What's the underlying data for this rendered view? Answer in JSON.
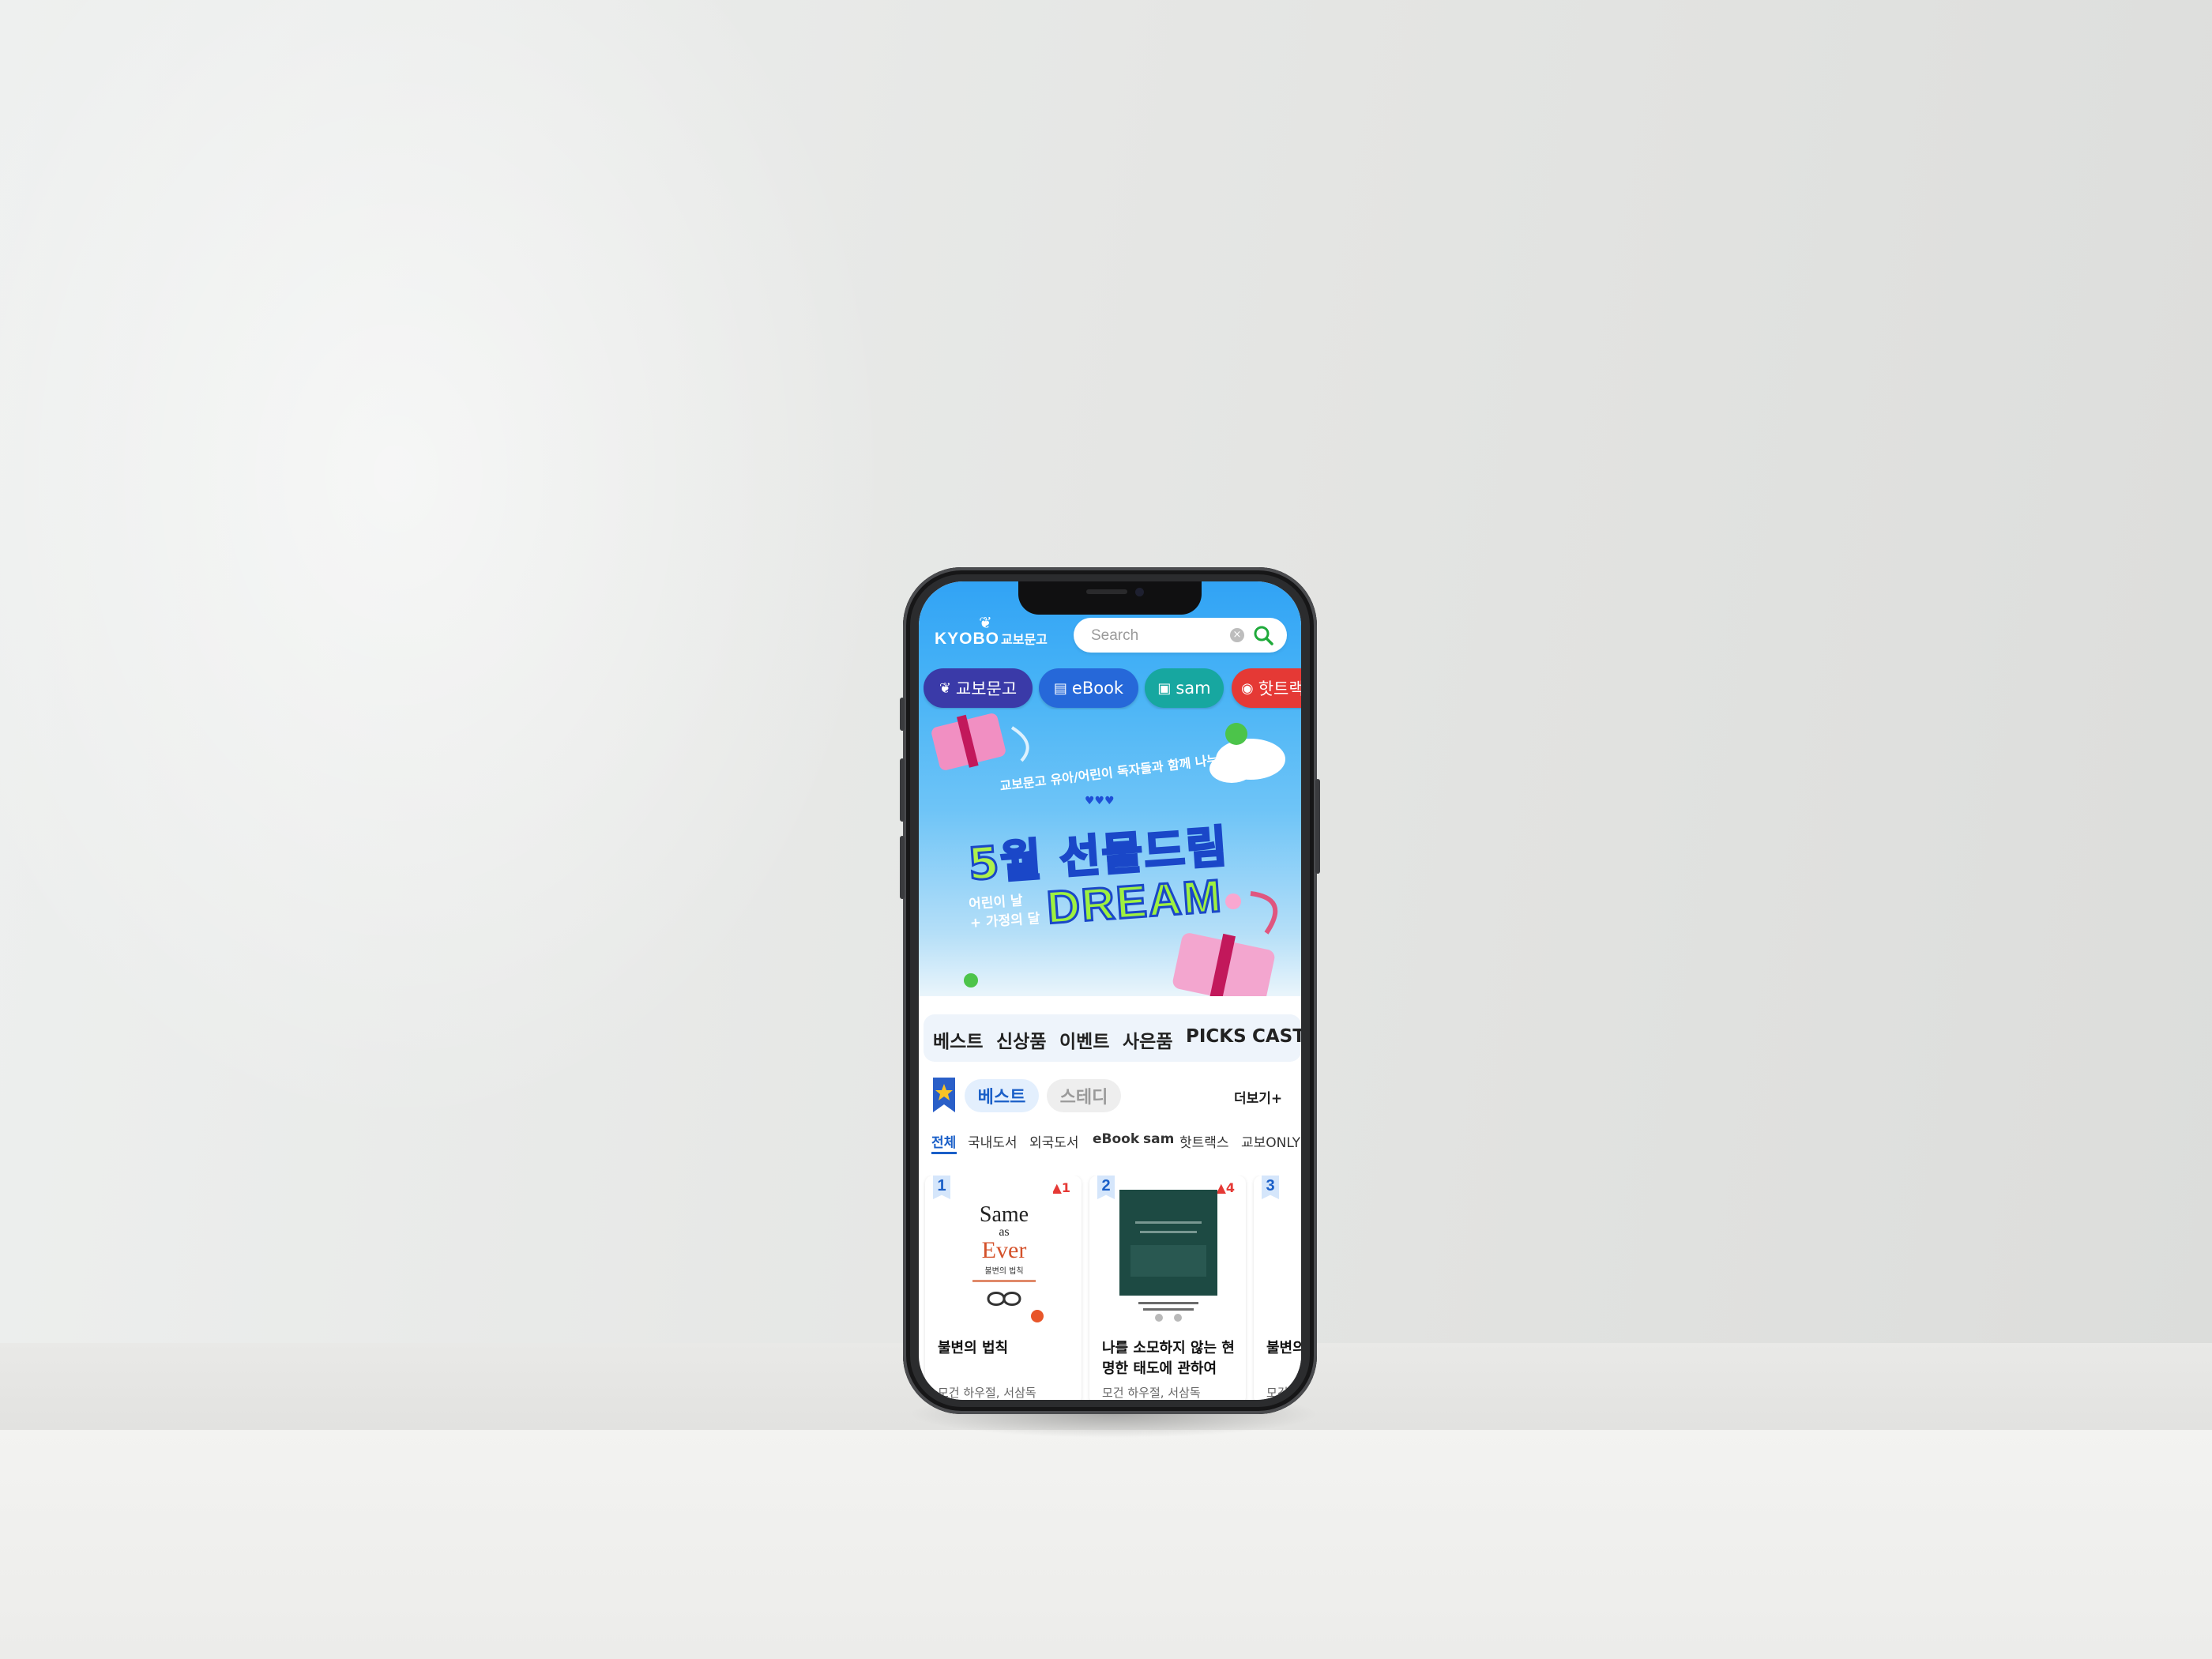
{
  "app": {
    "logo_text": "KYOBO",
    "logo_sub": "교보문고"
  },
  "search": {
    "placeholder": "Search"
  },
  "chips": [
    {
      "label": "교보문고",
      "icon": "bird-icon",
      "color": "#3a3aa8"
    },
    {
      "label": "eBook",
      "icon": "book-icon",
      "color": "#2668d9"
    },
    {
      "label": "sam",
      "icon": "tablet-icon",
      "color": "#17a7a0"
    },
    {
      "label": "핫트랙스",
      "icon": "target-icon",
      "color": "#e53935"
    }
  ],
  "banner": {
    "subtitle": "교보문고 유아/어린이 독자들과 함께 나누는",
    "hearts": "♥♥♥",
    "title": "5월 선물드림",
    "dream": "DREAM",
    "side_line1": "어린이 날",
    "side_line2": "+ 가정의 달"
  },
  "tabs": [
    "베스트",
    "신상품",
    "이벤트",
    "사은품",
    "PICKS",
    "CAST"
  ],
  "best": {
    "pill_active": "베스트",
    "pill_inactive": "스테디",
    "more": "더보기+",
    "subtabs": [
      "전체",
      "국내도서",
      "외국도서",
      "eBook",
      "sam",
      "핫트랙스",
      "교보ONLY"
    ],
    "books": [
      {
        "rank": "1",
        "delta": "▲1",
        "title": "불변의 법칙",
        "author": "모건 하우절, 서삼독",
        "cover_title1": "Same",
        "cover_title2": "as",
        "cover_title3": "Ever",
        "cover_ko": "불변의 법칙"
      },
      {
        "rank": "2",
        "delta": "▲4",
        "title": "나를 소모하지 않는 현명한 태도에 관하여",
        "author": "모건 하우절, 서삼독",
        "cover_title1": "",
        "cover_title2": "",
        "cover_title3": "",
        "cover_ko": ""
      },
      {
        "rank": "3",
        "delta": "",
        "title": "불변의",
        "author": "모건",
        "cover_title1": "",
        "cover_title2": "",
        "cover_title3": "",
        "cover_ko": ""
      }
    ]
  },
  "colors": {
    "accent": "#1a5fc8",
    "hero_top": "#31a3f5",
    "search_icon": "#1faa3b",
    "up_arrow": "#e53935"
  }
}
